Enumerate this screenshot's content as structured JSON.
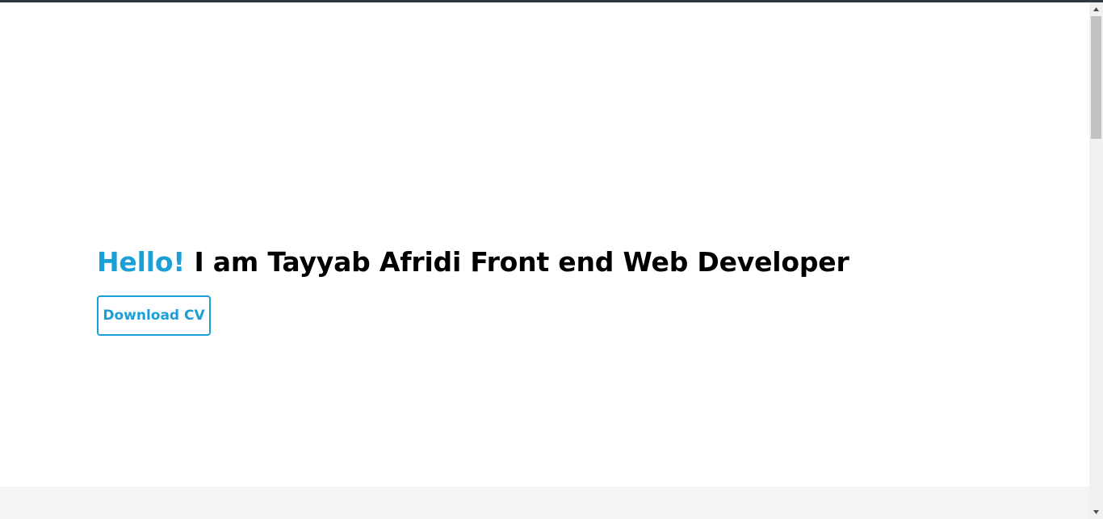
{
  "hero": {
    "greeting": "Hello!",
    "headline_rest": " I am Tayyab Afridi Front end Web Developer",
    "download_button": "Download CV"
  },
  "colors": {
    "accent": "#1a9fd6",
    "text": "#000000",
    "section_bg": "#f4f4f4",
    "top_border": "#2b3a3a"
  },
  "scrollbar": {
    "up_icon": "scroll-up-arrow-icon",
    "down_icon": "scroll-down-arrow-icon"
  }
}
